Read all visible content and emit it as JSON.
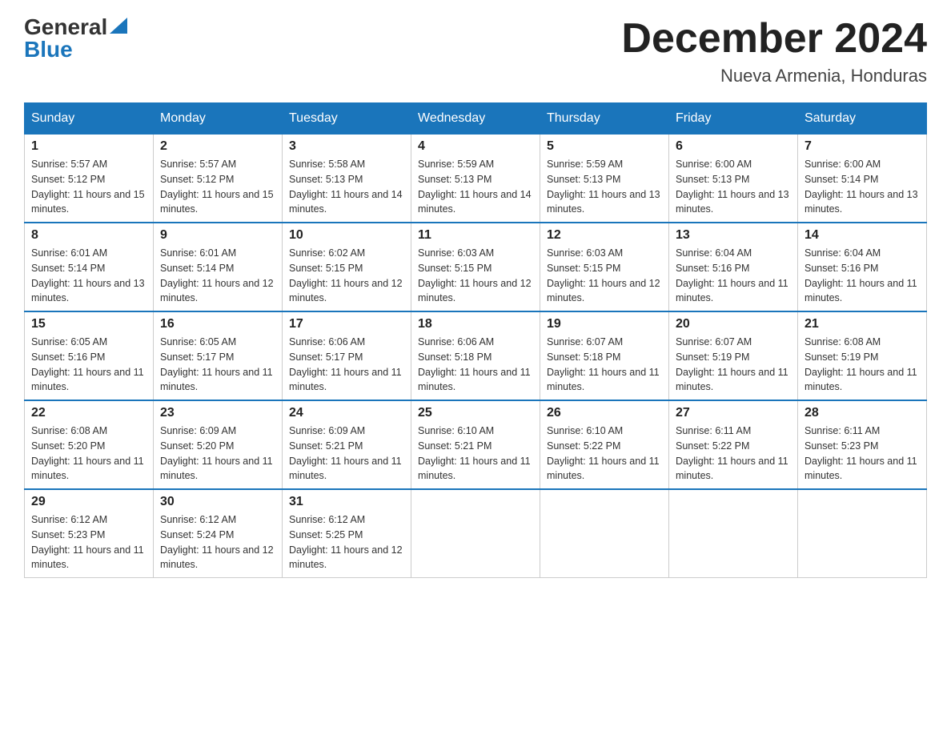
{
  "header": {
    "logo": {
      "general": "General",
      "blue": "Blue"
    },
    "title": "December 2024",
    "location": "Nueva Armenia, Honduras"
  },
  "days_of_week": [
    "Sunday",
    "Monday",
    "Tuesday",
    "Wednesday",
    "Thursday",
    "Friday",
    "Saturday"
  ],
  "weeks": [
    [
      {
        "day": "1",
        "sunrise": "Sunrise: 5:57 AM",
        "sunset": "Sunset: 5:12 PM",
        "daylight": "Daylight: 11 hours and 15 minutes."
      },
      {
        "day": "2",
        "sunrise": "Sunrise: 5:57 AM",
        "sunset": "Sunset: 5:12 PM",
        "daylight": "Daylight: 11 hours and 15 minutes."
      },
      {
        "day": "3",
        "sunrise": "Sunrise: 5:58 AM",
        "sunset": "Sunset: 5:13 PM",
        "daylight": "Daylight: 11 hours and 14 minutes."
      },
      {
        "day": "4",
        "sunrise": "Sunrise: 5:59 AM",
        "sunset": "Sunset: 5:13 PM",
        "daylight": "Daylight: 11 hours and 14 minutes."
      },
      {
        "day": "5",
        "sunrise": "Sunrise: 5:59 AM",
        "sunset": "Sunset: 5:13 PM",
        "daylight": "Daylight: 11 hours and 13 minutes."
      },
      {
        "day": "6",
        "sunrise": "Sunrise: 6:00 AM",
        "sunset": "Sunset: 5:13 PM",
        "daylight": "Daylight: 11 hours and 13 minutes."
      },
      {
        "day": "7",
        "sunrise": "Sunrise: 6:00 AM",
        "sunset": "Sunset: 5:14 PM",
        "daylight": "Daylight: 11 hours and 13 minutes."
      }
    ],
    [
      {
        "day": "8",
        "sunrise": "Sunrise: 6:01 AM",
        "sunset": "Sunset: 5:14 PM",
        "daylight": "Daylight: 11 hours and 13 minutes."
      },
      {
        "day": "9",
        "sunrise": "Sunrise: 6:01 AM",
        "sunset": "Sunset: 5:14 PM",
        "daylight": "Daylight: 11 hours and 12 minutes."
      },
      {
        "day": "10",
        "sunrise": "Sunrise: 6:02 AM",
        "sunset": "Sunset: 5:15 PM",
        "daylight": "Daylight: 11 hours and 12 minutes."
      },
      {
        "day": "11",
        "sunrise": "Sunrise: 6:03 AM",
        "sunset": "Sunset: 5:15 PM",
        "daylight": "Daylight: 11 hours and 12 minutes."
      },
      {
        "day": "12",
        "sunrise": "Sunrise: 6:03 AM",
        "sunset": "Sunset: 5:15 PM",
        "daylight": "Daylight: 11 hours and 12 minutes."
      },
      {
        "day": "13",
        "sunrise": "Sunrise: 6:04 AM",
        "sunset": "Sunset: 5:16 PM",
        "daylight": "Daylight: 11 hours and 11 minutes."
      },
      {
        "day": "14",
        "sunrise": "Sunrise: 6:04 AM",
        "sunset": "Sunset: 5:16 PM",
        "daylight": "Daylight: 11 hours and 11 minutes."
      }
    ],
    [
      {
        "day": "15",
        "sunrise": "Sunrise: 6:05 AM",
        "sunset": "Sunset: 5:16 PM",
        "daylight": "Daylight: 11 hours and 11 minutes."
      },
      {
        "day": "16",
        "sunrise": "Sunrise: 6:05 AM",
        "sunset": "Sunset: 5:17 PM",
        "daylight": "Daylight: 11 hours and 11 minutes."
      },
      {
        "day": "17",
        "sunrise": "Sunrise: 6:06 AM",
        "sunset": "Sunset: 5:17 PM",
        "daylight": "Daylight: 11 hours and 11 minutes."
      },
      {
        "day": "18",
        "sunrise": "Sunrise: 6:06 AM",
        "sunset": "Sunset: 5:18 PM",
        "daylight": "Daylight: 11 hours and 11 minutes."
      },
      {
        "day": "19",
        "sunrise": "Sunrise: 6:07 AM",
        "sunset": "Sunset: 5:18 PM",
        "daylight": "Daylight: 11 hours and 11 minutes."
      },
      {
        "day": "20",
        "sunrise": "Sunrise: 6:07 AM",
        "sunset": "Sunset: 5:19 PM",
        "daylight": "Daylight: 11 hours and 11 minutes."
      },
      {
        "day": "21",
        "sunrise": "Sunrise: 6:08 AM",
        "sunset": "Sunset: 5:19 PM",
        "daylight": "Daylight: 11 hours and 11 minutes."
      }
    ],
    [
      {
        "day": "22",
        "sunrise": "Sunrise: 6:08 AM",
        "sunset": "Sunset: 5:20 PM",
        "daylight": "Daylight: 11 hours and 11 minutes."
      },
      {
        "day": "23",
        "sunrise": "Sunrise: 6:09 AM",
        "sunset": "Sunset: 5:20 PM",
        "daylight": "Daylight: 11 hours and 11 minutes."
      },
      {
        "day": "24",
        "sunrise": "Sunrise: 6:09 AM",
        "sunset": "Sunset: 5:21 PM",
        "daylight": "Daylight: 11 hours and 11 minutes."
      },
      {
        "day": "25",
        "sunrise": "Sunrise: 6:10 AM",
        "sunset": "Sunset: 5:21 PM",
        "daylight": "Daylight: 11 hours and 11 minutes."
      },
      {
        "day": "26",
        "sunrise": "Sunrise: 6:10 AM",
        "sunset": "Sunset: 5:22 PM",
        "daylight": "Daylight: 11 hours and 11 minutes."
      },
      {
        "day": "27",
        "sunrise": "Sunrise: 6:11 AM",
        "sunset": "Sunset: 5:22 PM",
        "daylight": "Daylight: 11 hours and 11 minutes."
      },
      {
        "day": "28",
        "sunrise": "Sunrise: 6:11 AM",
        "sunset": "Sunset: 5:23 PM",
        "daylight": "Daylight: 11 hours and 11 minutes."
      }
    ],
    [
      {
        "day": "29",
        "sunrise": "Sunrise: 6:12 AM",
        "sunset": "Sunset: 5:23 PM",
        "daylight": "Daylight: 11 hours and 11 minutes."
      },
      {
        "day": "30",
        "sunrise": "Sunrise: 6:12 AM",
        "sunset": "Sunset: 5:24 PM",
        "daylight": "Daylight: 11 hours and 12 minutes."
      },
      {
        "day": "31",
        "sunrise": "Sunrise: 6:12 AM",
        "sunset": "Sunset: 5:25 PM",
        "daylight": "Daylight: 11 hours and 12 minutes."
      },
      null,
      null,
      null,
      null
    ]
  ]
}
